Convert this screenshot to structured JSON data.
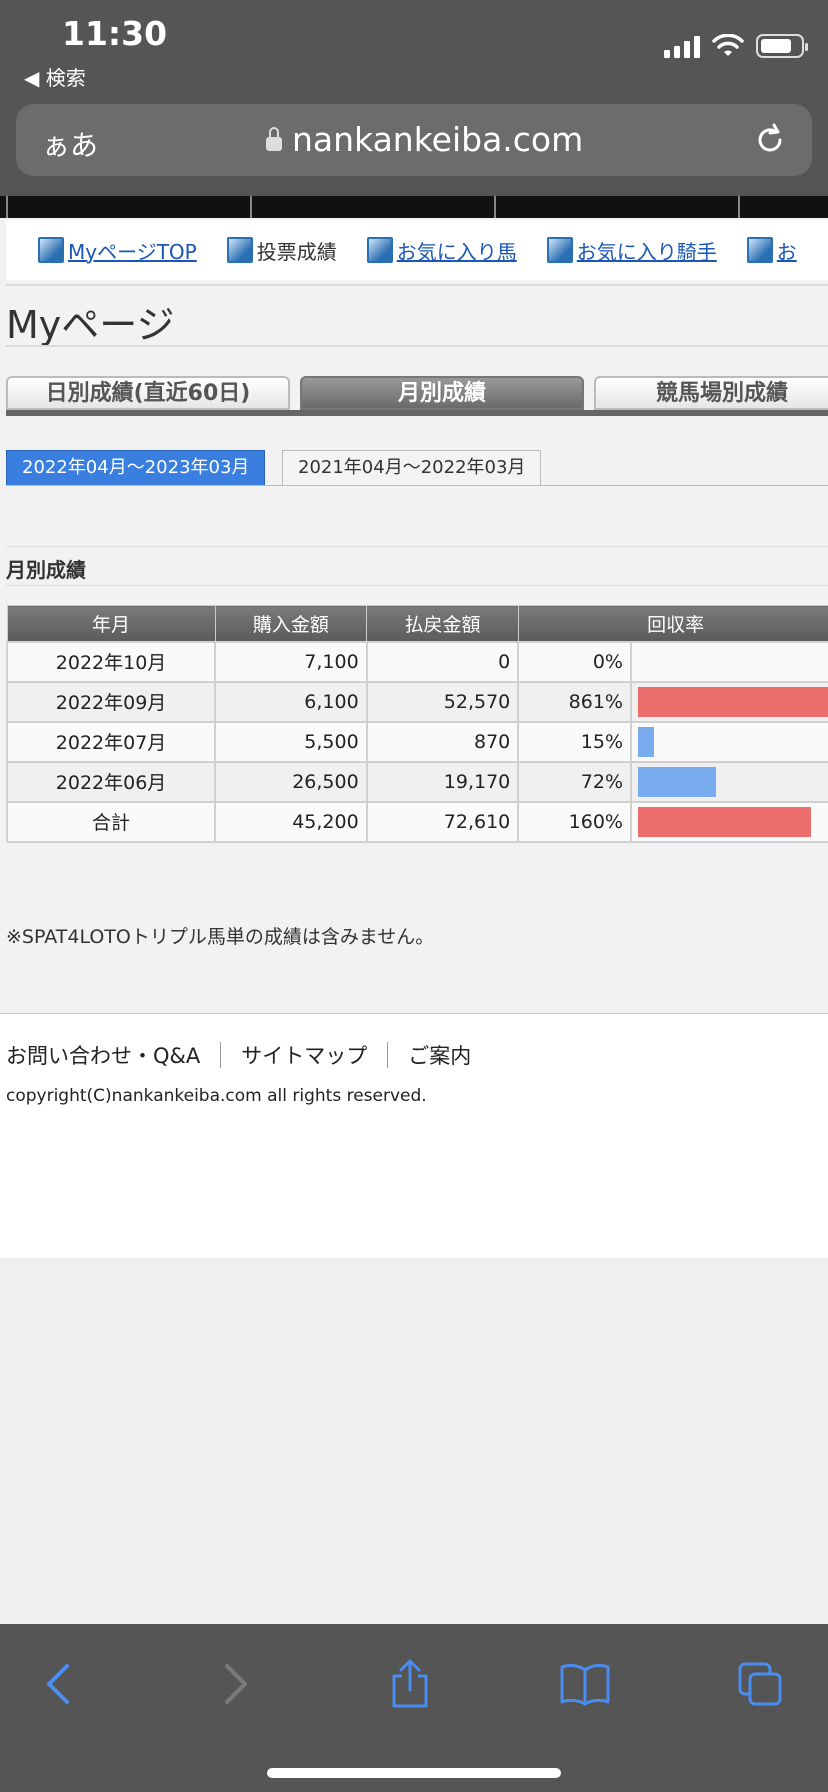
{
  "status_bar": {
    "time": "11:30",
    "back_app_label": "◀ 検索"
  },
  "address_bar": {
    "aa_label": "ぁあ",
    "url": "nankankeiba.com"
  },
  "sub_nav": {
    "items": [
      {
        "label": "MyページTOP",
        "link": true
      },
      {
        "label": "投票成績",
        "link": false
      },
      {
        "label": "お気に入り馬",
        "link": true
      },
      {
        "label": "お気に入り騎手",
        "link": true
      },
      {
        "label": "お",
        "link": true
      }
    ]
  },
  "page_title": "Myページ",
  "tabs": [
    {
      "label": "日別成績(直近60日)",
      "active": false
    },
    {
      "label": "月別成績",
      "active": true
    },
    {
      "label": "競馬場別成績",
      "active": false
    }
  ],
  "periods": [
    {
      "label": "2022年04月～2023年03月",
      "active": true
    },
    {
      "label": "2021年04月～2022年03月",
      "active": false
    }
  ],
  "section_title": "月別成績",
  "table": {
    "headers": [
      "年月",
      "購入金額",
      "払戻金額",
      "回収率"
    ],
    "rows": [
      {
        "month": "2022年10月",
        "purchase": "7,100",
        "payout": "0",
        "rate": "0%",
        "rate_value": 0
      },
      {
        "month": "2022年09月",
        "purchase": "6,100",
        "payout": "52,570",
        "rate": "861%",
        "rate_value": 861
      },
      {
        "month": "2022年07月",
        "purchase": "5,500",
        "payout": "870",
        "rate": "15%",
        "rate_value": 15
      },
      {
        "month": "2022年06月",
        "purchase": "26,500",
        "payout": "19,170",
        "rate": "72%",
        "rate_value": 72
      },
      {
        "month": "合計",
        "purchase": "45,200",
        "payout": "72,610",
        "rate": "160%",
        "rate_value": 160
      }
    ],
    "bar_colors": {
      "over_100": "#ec6e6c",
      "under_100": "#78acef"
    }
  },
  "note": "※SPAT4LOTOトリプル馬単の成績は含みません。",
  "footer": {
    "links": [
      "お問い合わせ・Q&A",
      "サイトマップ",
      "ご案内"
    ],
    "copyright": "copyright(C)nankankeiba.com all rights reserved."
  }
}
